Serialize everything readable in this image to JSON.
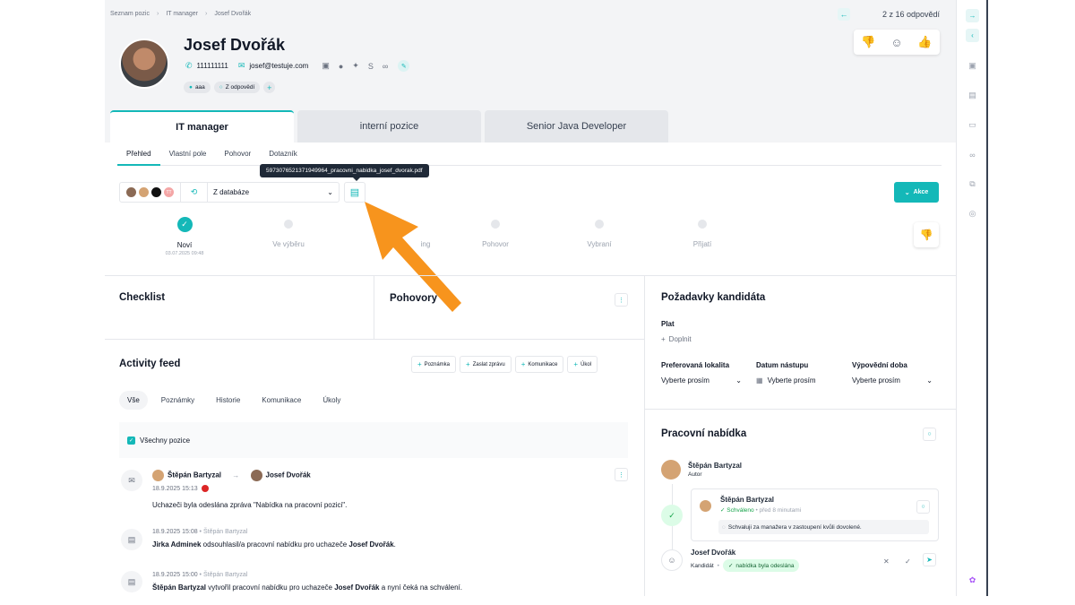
{
  "breadcrumb": [
    "Seznam pozic",
    "IT manager",
    "Josef Dvořák"
  ],
  "pager": {
    "text": "2 z 16 odpovědí"
  },
  "candidate": {
    "name": "Josef Dvořák",
    "phone": "111111111",
    "email": "josef@testuje.com",
    "tags": [
      "aaa",
      "Z odpovědí"
    ]
  },
  "positions": [
    "IT manager",
    "interní pozice",
    "Senior Java Developer"
  ],
  "subtabs": [
    "Přehled",
    "Vlastní pole",
    "Pohovor",
    "Dotazník"
  ],
  "tooltip": "5973076521371949964_pracovni_nabidka_josef_dvorak.pdf",
  "source": {
    "value": "Z databáze",
    "mini_initials": "TT"
  },
  "actions_label": "Akce",
  "pipeline": {
    "stages": [
      "Noví",
      "Ve výběru",
      "Pr",
      "ing",
      "Pohovor",
      "Vybraní",
      "Přijatí"
    ],
    "first_date": "03.07.2025 09:48"
  },
  "sections": {
    "checklist": "Checklist",
    "interviews": "Pohovory",
    "requirements": "Požadavky kandidáta",
    "activity": "Activity feed",
    "offer": "Pracovní nabídka"
  },
  "feed_buttons": [
    "Poznámka",
    "Zaslat zprávu",
    "Komunikace",
    "Úkol"
  ],
  "feed_tabs": [
    "Vše",
    "Poznámky",
    "Historie",
    "Komunikace",
    "Úkoly"
  ],
  "all_positions": "Všechny pozice",
  "feed": [
    {
      "from": "Štěpán Bartyzal",
      "to": "Josef Dvořák",
      "time": "18.9.2025 15:13",
      "text": "Uchazeči byla odeslána zpráva \"Nabídka na pracovní pozici\"."
    },
    {
      "time": "18.9.2025 15:08",
      "by": "Štěpán Bartyzal",
      "actor": "Jirka Adminek",
      "text": " odsouhlasil/a pracovní nabídku pro uchazeče ",
      "target": "Josef Dvořák",
      "end": "."
    },
    {
      "time": "18.9.2025 15:00",
      "by": "Štěpán Bartyzal",
      "actor": "Štěpán Bartyzal",
      "text": " vytvořil pracovní nabídku pro uchazeče ",
      "target": "Josef Dvořák",
      "end": " a nyní čeká na schválení."
    }
  ],
  "requirements": {
    "salary_label": "Plat",
    "salary_value": "Doplnit",
    "location_label": "Preferovaná lokalita",
    "location_value": "Vyberte prosím",
    "start_label": "Datum nástupu",
    "start_value": "Vyberte prosím",
    "notice_label": "Výpovědní doba",
    "notice_value": "Vyberte prosím"
  },
  "offer": {
    "author_name": "Štěpán Bartyzal",
    "author_role": "Autor",
    "approver_name": "Štěpán Bartyzal",
    "approved": "Schváleno",
    "approved_when": "před 8 minutami",
    "comment": "Schvaluji za manažera v zastoupení kvůli dovolené.",
    "candidate_name": "Josef Dvořák",
    "candidate_role": "Kandidát",
    "sent_badge": "nabídka byla odeslána"
  },
  "colors": {
    "accent": "#14b8b8",
    "arrow": "#f7941d"
  }
}
